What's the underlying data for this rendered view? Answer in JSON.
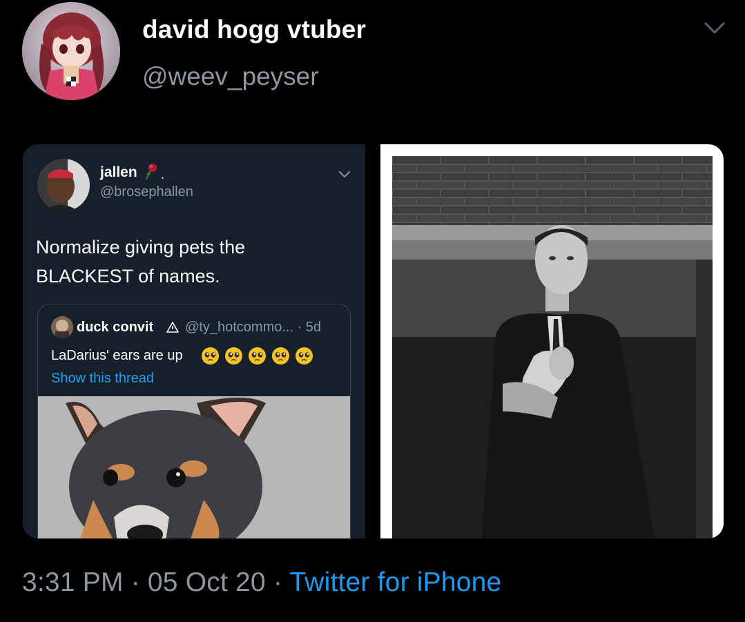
{
  "tweet": {
    "display_name": "david hogg vtuber",
    "handle": "@weev_peyser",
    "avatar_icon": "anime-avatar-icon",
    "menu_icon": "chevron-down-icon"
  },
  "embedded_tweet": {
    "display_name": "jallen",
    "name_suffix": ".",
    "handle": "@brosephallen",
    "body": "Normalize giving pets the BLACKEST of names.",
    "menu_icon": "chevron-down-icon",
    "quoted": {
      "display_name": "duck convit",
      "handle_time": "@ty_hotcommo... · 5d",
      "text": "LaDarius' ears are up",
      "emoji_count": 5,
      "show_thread": "Show this thread"
    }
  },
  "footer": {
    "time_date": "3:31 PM · 05 Oct 20 · ",
    "source": "Twitter for iPhone"
  },
  "colors": {
    "background": "#000000",
    "secondary_text": "#8e969f",
    "link": "#1d9bf0",
    "dark_card": "#15202b"
  }
}
